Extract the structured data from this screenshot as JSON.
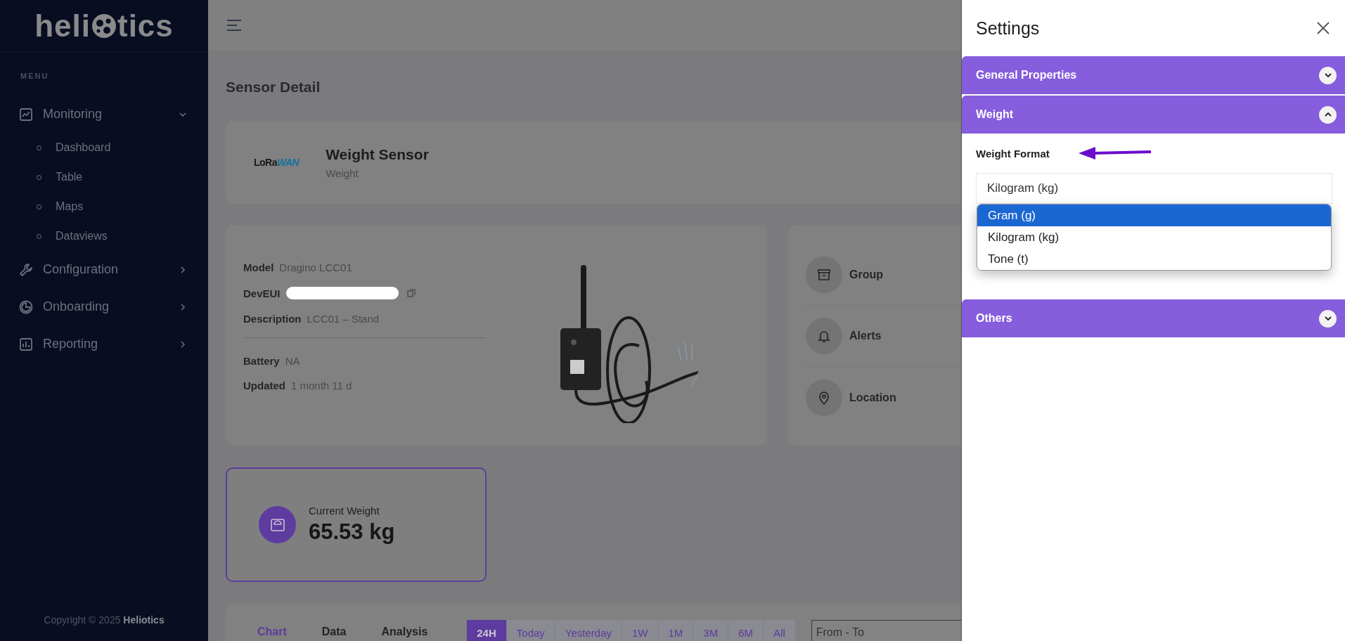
{
  "sidebar": {
    "logo": {
      "before_icon": "heli",
      "after_icon": "tics"
    },
    "menu_label": "MENU",
    "items": [
      {
        "label": "Monitoring",
        "expanded": true,
        "children": [
          {
            "label": "Dashboard"
          },
          {
            "label": "Table"
          },
          {
            "label": "Maps"
          },
          {
            "label": "Dataviews"
          }
        ]
      },
      {
        "label": "Configuration",
        "expanded": false
      },
      {
        "label": "Onboarding",
        "expanded": false
      },
      {
        "label": "Reporting",
        "expanded": false
      }
    ],
    "copyright": "Copyright © 2025 **Heliotics**"
  },
  "page_title": "Sensor Detail",
  "sensor": {
    "logo": "LoRaWAN",
    "name": "Weight Sensor",
    "type": "Weight"
  },
  "details": [
    [
      {
        "label": "Model",
        "value": "Dragino LCC01"
      },
      {
        "label": "DevEUI",
        "redacted": true,
        "copyable": true
      },
      {
        "label": "Description",
        "value": "LCC01 – Stand"
      }
    ],
    [
      {
        "label": "Battery",
        "value": "NA"
      },
      {
        "label": "Updated",
        "value": "1 month 11 d"
      }
    ]
  ],
  "actions": [
    {
      "label": "Group"
    },
    {
      "label": "Alerts"
    },
    {
      "label": "Location"
    }
  ],
  "current_weight": {
    "label": "Current Weight",
    "value": "65.53 kg"
  },
  "tabs": [
    {
      "label": "Chart",
      "selected": true
    },
    {
      "label": "Data",
      "selected": false
    },
    {
      "label": "Analysis",
      "selected": false
    }
  ],
  "ranges": [
    {
      "label": "24H",
      "selected": true
    },
    {
      "label": "Today",
      "selected": false
    },
    {
      "label": "Yesterday",
      "selected": false
    },
    {
      "label": "1W",
      "selected": false
    },
    {
      "label": "1M",
      "selected": false
    },
    {
      "label": "3M",
      "selected": false
    },
    {
      "label": "6M",
      "selected": false
    },
    {
      "label": "All",
      "selected": false
    }
  ],
  "date_range": {
    "placeholder": "From - To"
  },
  "settings": {
    "title": "Settings",
    "sections": [
      {
        "title": "General Properties",
        "expanded": false
      },
      {
        "title": "Weight",
        "expanded": true,
        "field": {
          "label": "Weight Format",
          "value": "Kilogram (kg)",
          "open": true,
          "options": [
            {
              "label": "Gram (g)",
              "highlighted": true
            },
            {
              "label": "Kilogram (kg)",
              "highlighted": false
            },
            {
              "label": "Tone (t)",
              "highlighted": false
            }
          ]
        }
      },
      {
        "title": "Others",
        "expanded": false
      }
    ]
  }
}
